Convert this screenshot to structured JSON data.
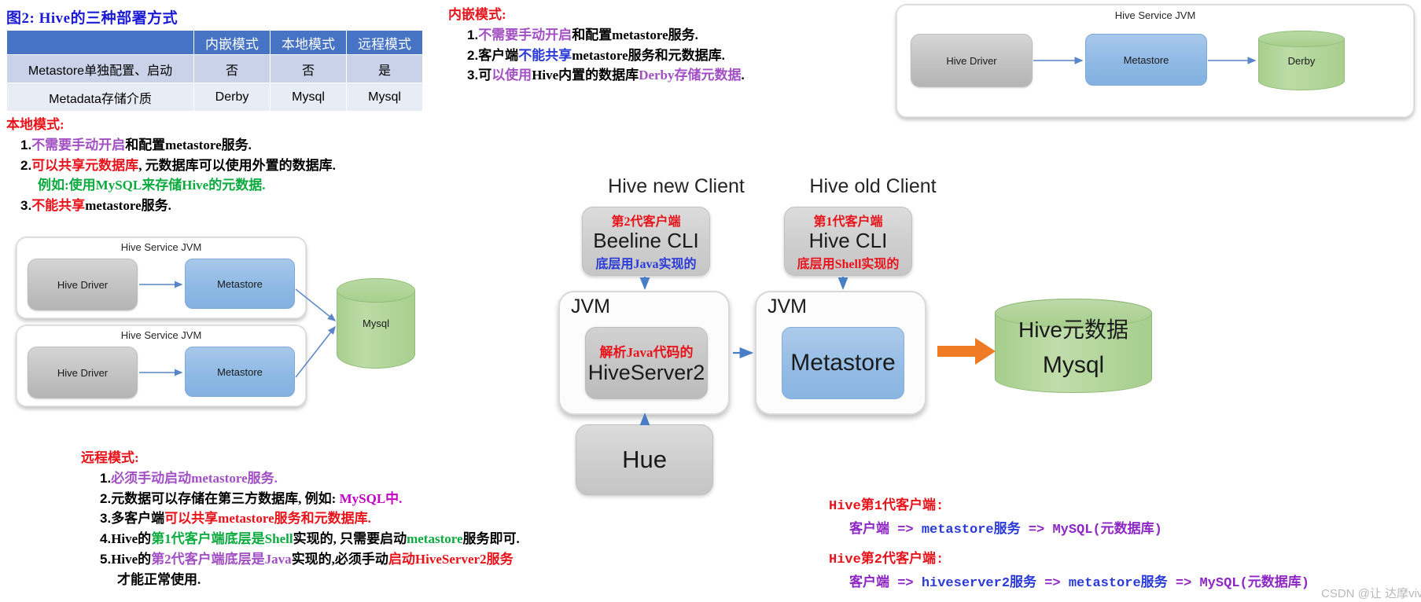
{
  "figure": {
    "title": "图2: Hive的三种部署方式"
  },
  "table": {
    "headers": [
      "",
      "内嵌模式",
      "本地模式",
      "远程模式"
    ],
    "rows": [
      {
        "label": "Metastore单独配置、启动",
        "values": [
          "否",
          "否",
          "是"
        ]
      },
      {
        "label": "Metadata存储介质",
        "values": [
          "Derby",
          "Mysql",
          "Mysql"
        ]
      }
    ]
  },
  "embedded_mode": {
    "heading": "内嵌模式:",
    "items": [
      {
        "num": "1.",
        "parts": [
          {
            "t": "不需要手动开启",
            "c": "c-purple"
          },
          {
            "t": "和配置metastore服务.",
            "c": "c-black"
          }
        ]
      },
      {
        "num": "2.",
        "parts": [
          {
            "t": "客户端",
            "c": "c-black"
          },
          {
            "t": "不能共享",
            "c": "c-blue"
          },
          {
            "t": "metastore服务和元数据库.",
            "c": "c-black"
          }
        ]
      },
      {
        "num": "3.",
        "parts": [
          {
            "t": "可",
            "c": "c-black"
          },
          {
            "t": "以使用",
            "c": "c-purple"
          },
          {
            "t": "Hive内置的数据库",
            "c": "c-black"
          },
          {
            "t": "Derby存储元数据",
            "c": "c-purple"
          },
          {
            "t": ".",
            "c": "c-black"
          }
        ]
      }
    ]
  },
  "local_mode": {
    "heading": "本地模式:",
    "items": [
      {
        "num": "1.",
        "parts": [
          {
            "t": "不需要手动开启",
            "c": "c-purple"
          },
          {
            "t": "和配置metastore服务.",
            "c": "c-black"
          }
        ]
      },
      {
        "num": "2.",
        "parts": [
          {
            "t": "可以共享元数据库",
            "c": "c-red"
          },
          {
            "t": ", 元数据库可以使用外置的数据库.",
            "c": "c-black"
          }
        ]
      },
      {
        "num": "",
        "parts": [
          {
            "t": "例如:使用MySQL来存储Hive的元数据.",
            "c": "c-green"
          }
        ]
      },
      {
        "num": "3.",
        "parts": [
          {
            "t": "不能共享",
            "c": "c-red"
          },
          {
            "t": "metastore服务.",
            "c": "c-black"
          }
        ]
      }
    ]
  },
  "remote_mode": {
    "heading": "远程模式:",
    "items": [
      {
        "num": "1.",
        "parts": [
          {
            "t": "必须手动启动metastore服务.",
            "c": "c-purple"
          }
        ]
      },
      {
        "num": "2.",
        "parts": [
          {
            "t": "元数据可以存储在第三方数据库, 例如: ",
            "c": "c-black"
          },
          {
            "t": "MySQL中.",
            "c": "c-mag"
          }
        ]
      },
      {
        "num": "3.",
        "parts": [
          {
            "t": "多客户端",
            "c": "c-black"
          },
          {
            "t": "可以共享metastore服务和元数据库.",
            "c": "c-red"
          }
        ]
      },
      {
        "num": "4.",
        "parts": [
          {
            "t": "Hive的",
            "c": "c-black"
          },
          {
            "t": "第1代客户端底层是Shell",
            "c": "c-green"
          },
          {
            "t": "实现的, 只需要启动",
            "c": "c-black"
          },
          {
            "t": "metastore",
            "c": "c-green"
          },
          {
            "t": "服务即可.",
            "c": "c-black"
          }
        ]
      },
      {
        "num": "5.",
        "parts": [
          {
            "t": "Hive的",
            "c": "c-black"
          },
          {
            "t": "第2代客户端底层是Java",
            "c": "c-purple"
          },
          {
            "t": "实现的,必须手动",
            "c": "c-black"
          },
          {
            "t": "启动HiveServer2服务",
            "c": "c-red"
          }
        ]
      },
      {
        "num": "",
        "parts": [
          {
            "t": "才能正常使用.",
            "c": "c-black"
          }
        ]
      }
    ]
  },
  "diagram_embedded": {
    "jvm_title": "Hive Service JVM",
    "driver": "Hive Driver",
    "metastore": "Metastore",
    "db": "Derby"
  },
  "diagram_local": {
    "jvm_title_1": "Hive Service JVM",
    "jvm_title_2": "Hive Service JVM",
    "driver_1": "Hive Driver",
    "driver_2": "Hive Driver",
    "metastore_1": "Metastore",
    "metastore_2": "Metastore",
    "db": "Mysql"
  },
  "diagram_remote": {
    "new_client_heading": "Hive new Client",
    "old_client_heading": "Hive old Client",
    "new_client": {
      "top": "第2代客户端",
      "main": "Beeline CLI",
      "bottom": "底层用Java实现的"
    },
    "old_client": {
      "top": "第1代客户端",
      "main": "Hive CLI",
      "bottom": "底层用Shell实现的"
    },
    "jvm_left_label": "JVM",
    "jvm_right_label": "JVM",
    "hiveserver2_top": "解析Java代码的",
    "hiveserver2_main": "HiveServer2",
    "metastore": "Metastore",
    "hue": "Hue",
    "mysql_top": "Hive元数据",
    "mysql_main": "Mysql"
  },
  "flow_notes": {
    "gen1_heading": "Hive第1代客户端:",
    "gen1_flow": [
      {
        "t": "客户端 => ",
        "c": "c-dpurple"
      },
      {
        "t": "metastore服务",
        "c": "c-blue"
      },
      {
        "t": " => ",
        "c": "c-dpurple"
      },
      {
        "t": "MySQL",
        "c": "c-dpurple"
      },
      {
        "t": "(元数据库)",
        "c": "c-dpurple"
      }
    ],
    "gen2_heading": "Hive第2代客户端:",
    "gen2_flow": [
      {
        "t": "客户端 => ",
        "c": "c-dpurple"
      },
      {
        "t": "hiveserver2服务",
        "c": "c-blue"
      },
      {
        "t": " => ",
        "c": "c-dpurple"
      },
      {
        "t": "metastore服务",
        "c": "c-blue"
      },
      {
        "t": " => ",
        "c": "c-dpurple"
      },
      {
        "t": "MySQL(元数据库)",
        "c": "c-dpurple"
      }
    ]
  },
  "watermark": {
    "text": "CSDN @让 达摩vivo"
  },
  "colors": {
    "table_header_bg": "#4673c3",
    "table_row1_bg": "#c9d2e8",
    "table_row2_bg": "#e8ecf5",
    "node_grey": "#c2c2c2",
    "node_blue": "#8cb8e4",
    "cylinder_green": "#a8cf8e",
    "arrow_blue": "#5b86c8",
    "arrow_orange": "#ee7b23",
    "title_blue": "#1a1ad6",
    "accent_red": "#e8131a"
  }
}
